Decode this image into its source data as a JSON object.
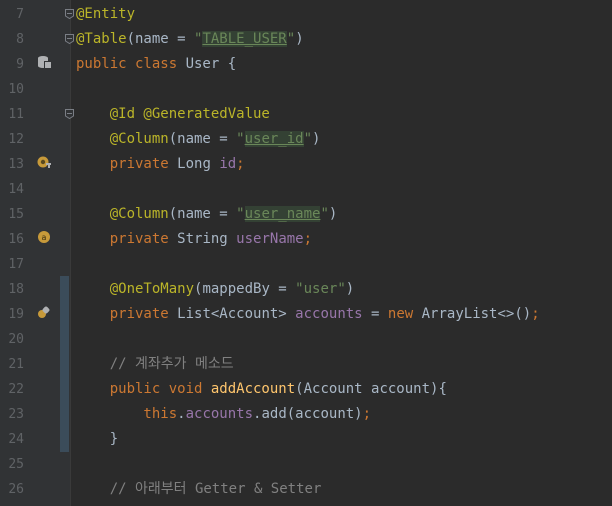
{
  "lines": [
    {
      "num": "7",
      "parts": [
        {
          "t": "@Entity",
          "c": "ann"
        }
      ]
    },
    {
      "num": "8",
      "parts": [
        {
          "t": "@Table",
          "c": "ann"
        },
        {
          "t": "(name = ",
          "c": ""
        },
        {
          "t": "\"",
          "c": "str"
        },
        {
          "t": "TABLE_USER",
          "c": "str hl"
        },
        {
          "t": "\"",
          "c": "str"
        },
        {
          "t": ")",
          "c": ""
        }
      ]
    },
    {
      "num": "9",
      "parts": [
        {
          "t": "public class ",
          "c": "kw"
        },
        {
          "t": "User {",
          "c": ""
        }
      ]
    },
    {
      "num": "10",
      "parts": []
    },
    {
      "num": "11",
      "parts": [
        {
          "t": "    @Id @GeneratedValue",
          "c": "ann"
        }
      ]
    },
    {
      "num": "12",
      "parts": [
        {
          "t": "    @Column",
          "c": "ann"
        },
        {
          "t": "(name = ",
          "c": ""
        },
        {
          "t": "\"",
          "c": "str"
        },
        {
          "t": "user_id",
          "c": "str hl"
        },
        {
          "t": "\"",
          "c": "str"
        },
        {
          "t": ")",
          "c": ""
        }
      ]
    },
    {
      "num": "13",
      "parts": [
        {
          "t": "    private ",
          "c": "kw"
        },
        {
          "t": "Long ",
          "c": ""
        },
        {
          "t": "id",
          "c": "fld"
        },
        {
          "t": ";",
          "c": "kw"
        }
      ]
    },
    {
      "num": "14",
      "parts": []
    },
    {
      "num": "15",
      "parts": [
        {
          "t": "    @Column",
          "c": "ann"
        },
        {
          "t": "(name = ",
          "c": ""
        },
        {
          "t": "\"",
          "c": "str"
        },
        {
          "t": "user_name",
          "c": "str hl"
        },
        {
          "t": "\"",
          "c": "str"
        },
        {
          "t": ")",
          "c": ""
        }
      ]
    },
    {
      "num": "16",
      "parts": [
        {
          "t": "    private ",
          "c": "kw"
        },
        {
          "t": "String ",
          "c": ""
        },
        {
          "t": "userName",
          "c": "fld"
        },
        {
          "t": ";",
          "c": "kw"
        }
      ]
    },
    {
      "num": "17",
      "parts": []
    },
    {
      "num": "18",
      "parts": [
        {
          "t": "    @OneToMany",
          "c": "ann"
        },
        {
          "t": "(mappedBy = ",
          "c": ""
        },
        {
          "t": "\"user\"",
          "c": "str"
        },
        {
          "t": ")",
          "c": ""
        }
      ]
    },
    {
      "num": "19",
      "parts": [
        {
          "t": "    private ",
          "c": "kw"
        },
        {
          "t": "List<Account> ",
          "c": ""
        },
        {
          "t": "accounts",
          "c": "fld"
        },
        {
          "t": " = ",
          "c": ""
        },
        {
          "t": "new ",
          "c": "kw"
        },
        {
          "t": "ArrayList<>()",
          "c": ""
        },
        {
          "t": ";",
          "c": "kw"
        }
      ]
    },
    {
      "num": "20",
      "parts": []
    },
    {
      "num": "21",
      "parts": [
        {
          "t": "    // 계좌추가 메소드",
          "c": "cmt"
        }
      ]
    },
    {
      "num": "22",
      "parts": [
        {
          "t": "    public void ",
          "c": "kw"
        },
        {
          "t": "addAccount",
          "c": "fn"
        },
        {
          "t": "(Account account){",
          "c": ""
        }
      ]
    },
    {
      "num": "23",
      "parts": [
        {
          "t": "        this",
          "c": "kw"
        },
        {
          "t": ".",
          "c": ""
        },
        {
          "t": "accounts",
          "c": "fld"
        },
        {
          "t": ".add(account)",
          "c": ""
        },
        {
          "t": ";",
          "c": "kw"
        }
      ]
    },
    {
      "num": "24",
      "parts": [
        {
          "t": "    }",
          "c": ""
        }
      ]
    },
    {
      "num": "25",
      "parts": []
    },
    {
      "num": "26",
      "parts": [
        {
          "t": "    // 아래부터 Getter & Setter",
          "c": "cmt"
        }
      ]
    }
  ]
}
